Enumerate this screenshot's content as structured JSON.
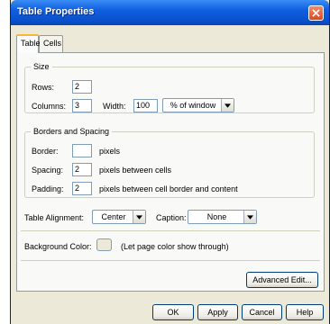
{
  "window": {
    "title": "Table Properties"
  },
  "tabs": [
    {
      "label": "Table"
    },
    {
      "label": "Cells"
    }
  ],
  "size": {
    "legend": "Size",
    "rows_label": "Rows:",
    "rows_value": "2",
    "columns_label": "Columns:",
    "columns_value": "3",
    "width_label": "Width:",
    "width_value": "100",
    "width_unit": "% of window"
  },
  "borders": {
    "legend": "Borders and Spacing",
    "border_label": "Border:",
    "border_value": "",
    "border_unit": "pixels",
    "spacing_label": "Spacing:",
    "spacing_value": "2",
    "spacing_unit": "pixels between cells",
    "padding_label": "Padding:",
    "padding_value": "2",
    "padding_unit": "pixels between cell border and content"
  },
  "alignment": {
    "label": "Table Alignment:",
    "value": "Center",
    "caption_label": "Caption:",
    "caption_value": "None"
  },
  "background": {
    "label": "Background Color:",
    "note": "(Let page color show through)",
    "swatch_color": "#ece9d8"
  },
  "buttons": {
    "advanced_edit": "Advanced Edit...",
    "ok": "OK",
    "apply": "Apply",
    "cancel": "Cancel",
    "help": "Help"
  }
}
